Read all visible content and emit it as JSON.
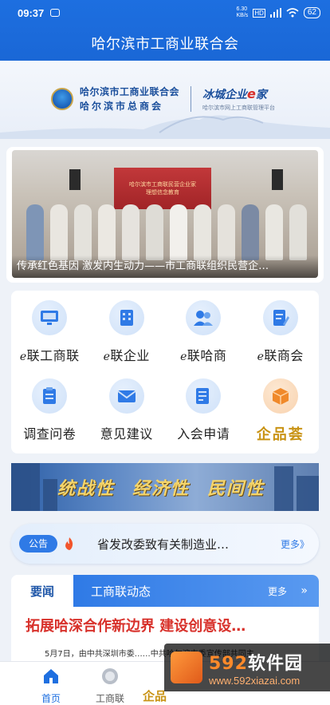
{
  "status": {
    "time": "09:37",
    "net_speed": "6.30\nKB/s",
    "battery": "62"
  },
  "app": {
    "title": "哈尔滨市工商业联合会"
  },
  "banner": {
    "org_line1": "哈尔滨市工商业联合会",
    "org_line2": "哈尔滨市总商会",
    "brand_prefix": "冰城企业",
    "brand_e": "e",
    "brand_suffix": "家",
    "brand_sub": "哈尔滨市网上工商联管理平台"
  },
  "news_slider": {
    "caption": "传承红色基因 激发内生动力——市工商联组织民营企…",
    "screen_text": "哈尔滨市工商联民营企业家\n理想信念教育"
  },
  "menu": [
    {
      "prefix": "e",
      "label": "联工商联",
      "icon": "monitor-icon"
    },
    {
      "prefix": "e",
      "label": "联企业",
      "icon": "building-icon"
    },
    {
      "prefix": "e",
      "label": "联哈商",
      "icon": "users-icon"
    },
    {
      "prefix": "e",
      "label": "联商会",
      "icon": "document-edit-icon"
    },
    {
      "prefix": "",
      "label": "调查问卷",
      "icon": "clipboard-icon"
    },
    {
      "prefix": "",
      "label": "意见建议",
      "icon": "mail-icon"
    },
    {
      "prefix": "",
      "label": "入会申请",
      "icon": "form-icon"
    },
    {
      "prefix": "",
      "label": "企品荟",
      "icon": "box-icon"
    }
  ],
  "slogan": {
    "items": [
      "统战性",
      "经济性",
      "民间性"
    ]
  },
  "notice": {
    "tag": "公告",
    "text": "省发改委致有关制造业…",
    "more": "更多》"
  },
  "news_tabs": {
    "tab1": "要闻",
    "tab2": "工商联动态",
    "more": "更多",
    "headline": "拓展哈深合作新边界 建设创意设…",
    "summary": "5月7日，由中共深圳市委……中共哈尔滨市委宣传部共同主"
  },
  "bottom_nav": [
    {
      "label": "首页"
    },
    {
      "label": "工商联"
    },
    {
      "label": "企品"
    }
  ],
  "watermark": {
    "num": "592",
    "name": "软件园",
    "url": "www.592xiazai.com"
  },
  "colors": {
    "primary": "#1d6fe0",
    "accent_red": "#d8312b",
    "gold": "#c99314"
  }
}
